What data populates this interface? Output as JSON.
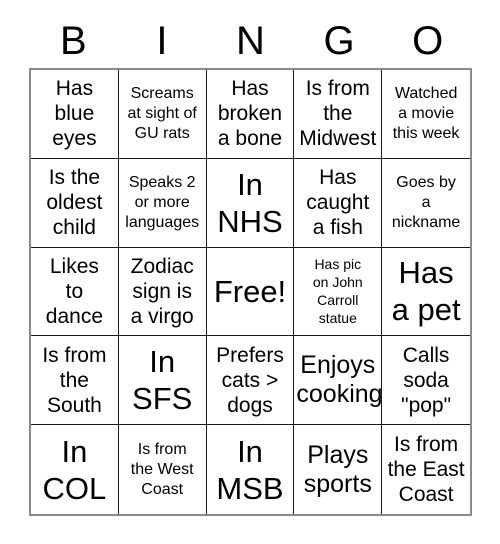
{
  "card": {
    "title": "BINGO",
    "header_letters": [
      "B",
      "I",
      "N",
      "G",
      "O"
    ],
    "grid_size": "5x5",
    "colors": {
      "text": "#000000",
      "background": "#ffffff",
      "outer_border": "#8a8a8a",
      "cell_border": "#1a1a1a"
    },
    "cells": [
      {
        "text": "Has\nblue\neyes",
        "size": "md",
        "free": false
      },
      {
        "text": "Screams\nat sight of\nGU rats",
        "size": "sm",
        "free": false
      },
      {
        "text": "Has\nbroken\na bone",
        "size": "md",
        "free": false
      },
      {
        "text": "Is from\nthe\nMidwest",
        "size": "md",
        "free": false
      },
      {
        "text": "Watched\na movie\nthis week",
        "size": "sm",
        "free": false
      },
      {
        "text": "Is the\noldest\nchild",
        "size": "md",
        "free": false
      },
      {
        "text": "Speaks 2\nor more\nlanguages",
        "size": "sm",
        "free": false
      },
      {
        "text": "In\nNHS",
        "size": "xl",
        "free": false
      },
      {
        "text": "Has\ncaught\na fish",
        "size": "md",
        "free": false
      },
      {
        "text": "Goes by\na\nnickname",
        "size": "sm",
        "free": false
      },
      {
        "text": "Likes\nto\ndance",
        "size": "md",
        "free": false
      },
      {
        "text": "Zodiac\nsign is\na virgo",
        "size": "md",
        "free": false
      },
      {
        "text": "Free!",
        "size": "xl",
        "free": true
      },
      {
        "text": "Has pic\non John\nCarroll\nstatue",
        "size": "xs",
        "free": false
      },
      {
        "text": "Has\na pet",
        "size": "xl",
        "free": false
      },
      {
        "text": "Is from\nthe\nSouth",
        "size": "md",
        "free": false
      },
      {
        "text": "In\nSFS",
        "size": "xl",
        "free": false
      },
      {
        "text": "Prefers\ncats >\ndogs",
        "size": "md",
        "free": false
      },
      {
        "text": "Enjoys\ncooking",
        "size": "lg",
        "free": false
      },
      {
        "text": "Calls\nsoda\n\"pop\"",
        "size": "md",
        "free": false
      },
      {
        "text": "In\nCOL",
        "size": "xl",
        "free": false
      },
      {
        "text": "Is from\nthe West\nCoast",
        "size": "sm",
        "free": false
      },
      {
        "text": "In\nMSB",
        "size": "xl",
        "free": false
      },
      {
        "text": "Plays\nsports",
        "size": "lg",
        "free": false
      },
      {
        "text": "Is from\nthe East\nCoast",
        "size": "md",
        "free": false
      }
    ]
  }
}
